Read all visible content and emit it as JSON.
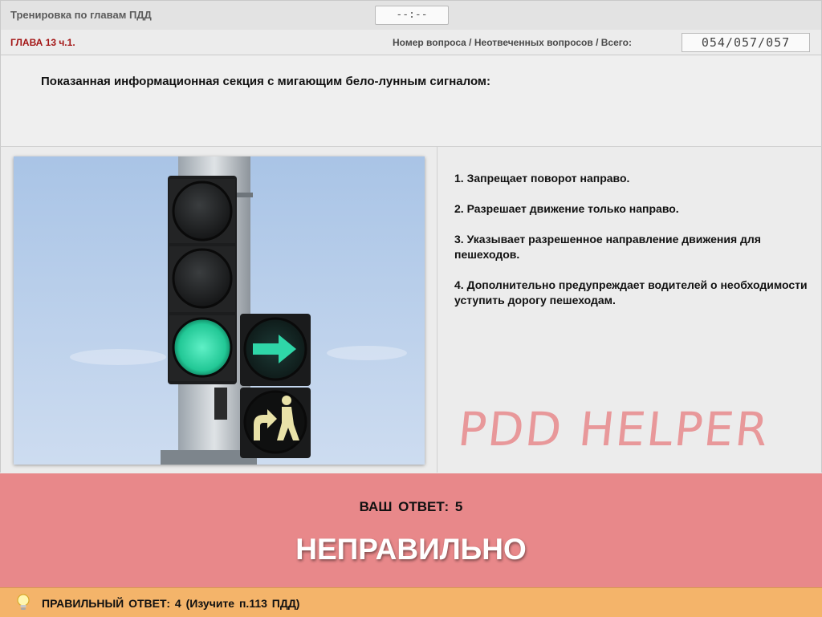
{
  "header": {
    "app_title": "Тренировка по главам ПДД",
    "timer": "--:--"
  },
  "info": {
    "chapter": "ГЛАВА 13 ч.1.",
    "counter_label": "Номер вопроса / Неотвеченных вопросов / Всего:",
    "counter_value": "054/057/057"
  },
  "question": {
    "text": "Показанная информационная секция с мигающим бело-лунным сигналом:"
  },
  "answers": [
    {
      "text": "1.  Запрещает поворот направо."
    },
    {
      "text": "2.  Разрешает движение только направо."
    },
    {
      "text": "3.  Указывает разрешенное направление движения для пешеходов."
    },
    {
      "text": "4.  Дополнительно предупреждает водителей о необходимости уступить дорогу пешеходам."
    }
  ],
  "watermark": "PDD HELPER",
  "result": {
    "your_answer": "ВАШ  ОТВЕТ:   5",
    "verdict": "НЕПРАВИЛЬНО",
    "correct_answer": "ПРАВИЛЬНЫЙ ОТВЕТ:   4   (Изучите п.113 ПДД)"
  },
  "colors": {
    "result_bg": "#e8888a",
    "bottom_bar_bg": "#f4b46a",
    "chapter_text": "#a31515",
    "signal_green": "#2fd6a8"
  },
  "icons": {
    "hint": "lightbulb-icon"
  }
}
